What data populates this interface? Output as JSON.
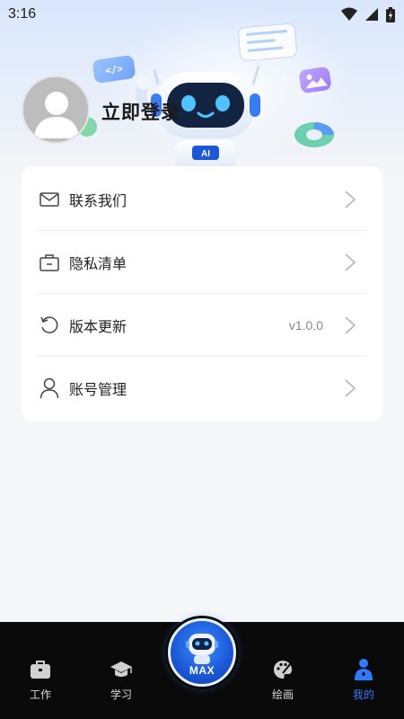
{
  "status_bar": {
    "time": "3:16",
    "icons": [
      "wifi-icon",
      "signal-icon",
      "battery-icon"
    ]
  },
  "hero": {
    "code_card_text": "</>",
    "robot_badge": "AI"
  },
  "profile": {
    "login_text": "立即登录"
  },
  "menu": {
    "items": [
      {
        "label": "联系我们",
        "icon": "mail-icon",
        "value": ""
      },
      {
        "label": "隐私清单",
        "icon": "briefcase-icon",
        "value": ""
      },
      {
        "label": "版本更新",
        "icon": "refresh-icon",
        "value": "v1.0.0"
      },
      {
        "label": "账号管理",
        "icon": "user-icon",
        "value": ""
      }
    ]
  },
  "bottom_nav": {
    "items": [
      {
        "label": "工作",
        "icon": "briefcase-icon",
        "active": false
      },
      {
        "label": "学习",
        "icon": "graduation-cap-icon",
        "active": false
      },
      {
        "label": "绘画",
        "icon": "palette-icon",
        "active": false
      },
      {
        "label": "我的",
        "icon": "person-icon",
        "active": true
      }
    ],
    "center": {
      "label": "MAX",
      "icon": "robot-icon"
    }
  },
  "colors": {
    "accent": "#2f7bff",
    "nav_background": "#0a0a0a",
    "page_background": "#f6f7f9"
  }
}
